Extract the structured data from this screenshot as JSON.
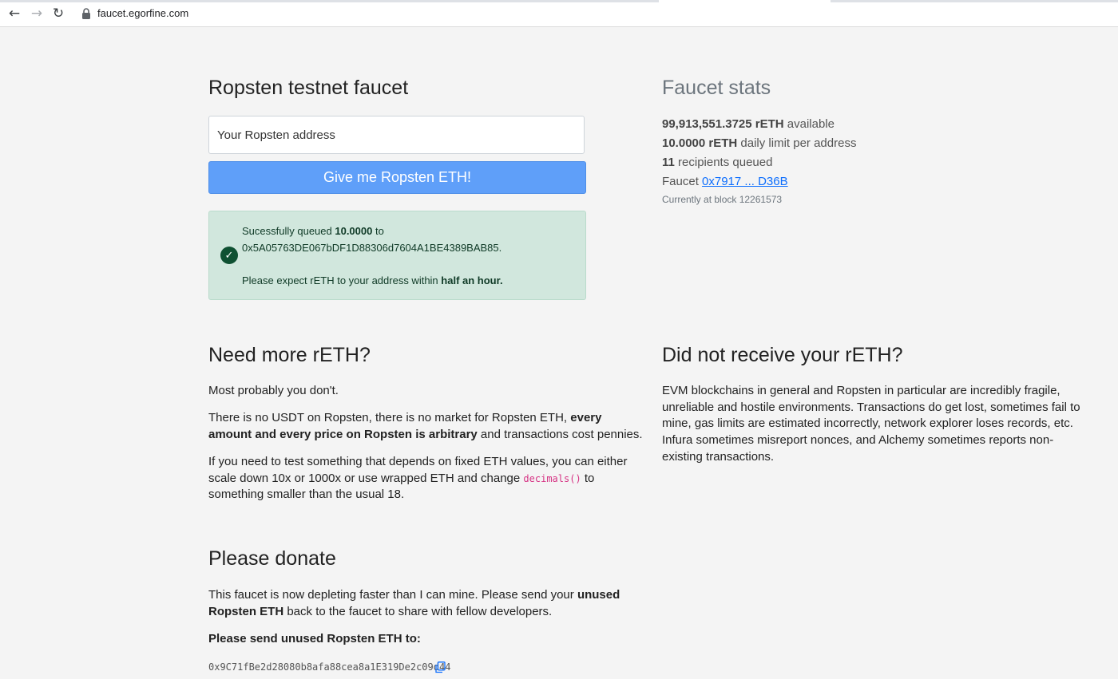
{
  "browser": {
    "url": "faucet.egorfine.com",
    "back_icon": "arrow-left-icon",
    "forward_icon": "arrow-right-icon",
    "reload_icon": "reload-icon",
    "lock_icon": "lock-icon"
  },
  "faucet": {
    "title": "Ropsten testnet faucet",
    "address_placeholder": "Your Ropsten address",
    "button_label": "Give me Ropsten ETH!",
    "alert": {
      "prefix": "Sucessfully queued ",
      "amount": "10.0000",
      "to_word": " to",
      "address": "0x5A05763DE067bDF1D88306d7604A1BE4389BAB85.",
      "expect_text": "Please expect rETH to your address within ",
      "expect_bold": "half an hour."
    }
  },
  "stats": {
    "title": "Faucet stats",
    "available_value": "99,913,551.3725 rETH",
    "available_label": " available",
    "limit_value": "10.0000 rETH",
    "limit_label": " daily limit per address",
    "queued_value": "11",
    "queued_label": " recipients queued",
    "faucet_label": "Faucet ",
    "faucet_link": "0x7917 ... D36B",
    "block_text": "Currently at block 12261573"
  },
  "need_more": {
    "title": "Need more rETH?",
    "p1": "Most probably you don't.",
    "p2_a": "There is no USDT on Ropsten, there is no market for Ropsten ETH, ",
    "p2_b": "every amount and every price on Ropsten is arbitrary",
    "p2_c": " and transactions cost pennies.",
    "p3_a": "If you need to test something that depends on fixed ETH values, you can either scale down 10x or 1000x or use wrapped ETH and change ",
    "p3_code": "decimals()",
    "p3_c": " to something smaller than the usual 18."
  },
  "not_received": {
    "title": "Did not receive your rETH?",
    "p1": "EVM blockchains in general and Ropsten in particular are incredibly fragile, unreliable and hostile environments. Transactions do get lost, sometimes fail to mine, gas limits are estimated incorrectly, network explorer loses records, etc. Infura sometimes misreport nonces, and Alchemy sometimes reports non-existing transactions."
  },
  "donate": {
    "title": "Please donate",
    "p1_a": "This faucet is now depleting faster than I can mine. Please send your ",
    "p1_b": "unused Ropsten ETH",
    "p1_c": " back to the faucet to share with fellow developers.",
    "send_label": "Please send unused Ropsten ETH to:",
    "address": "0x9C71fBe2d28080b8afa88cea8a1E319De2c09d44",
    "copy_icon": "copy-icon"
  },
  "colors": {
    "background": "#f4f4f4",
    "button": "#5f9ff9",
    "alert_bg": "#d1e7dd",
    "link": "#0d6efd",
    "code": "#d63384"
  }
}
